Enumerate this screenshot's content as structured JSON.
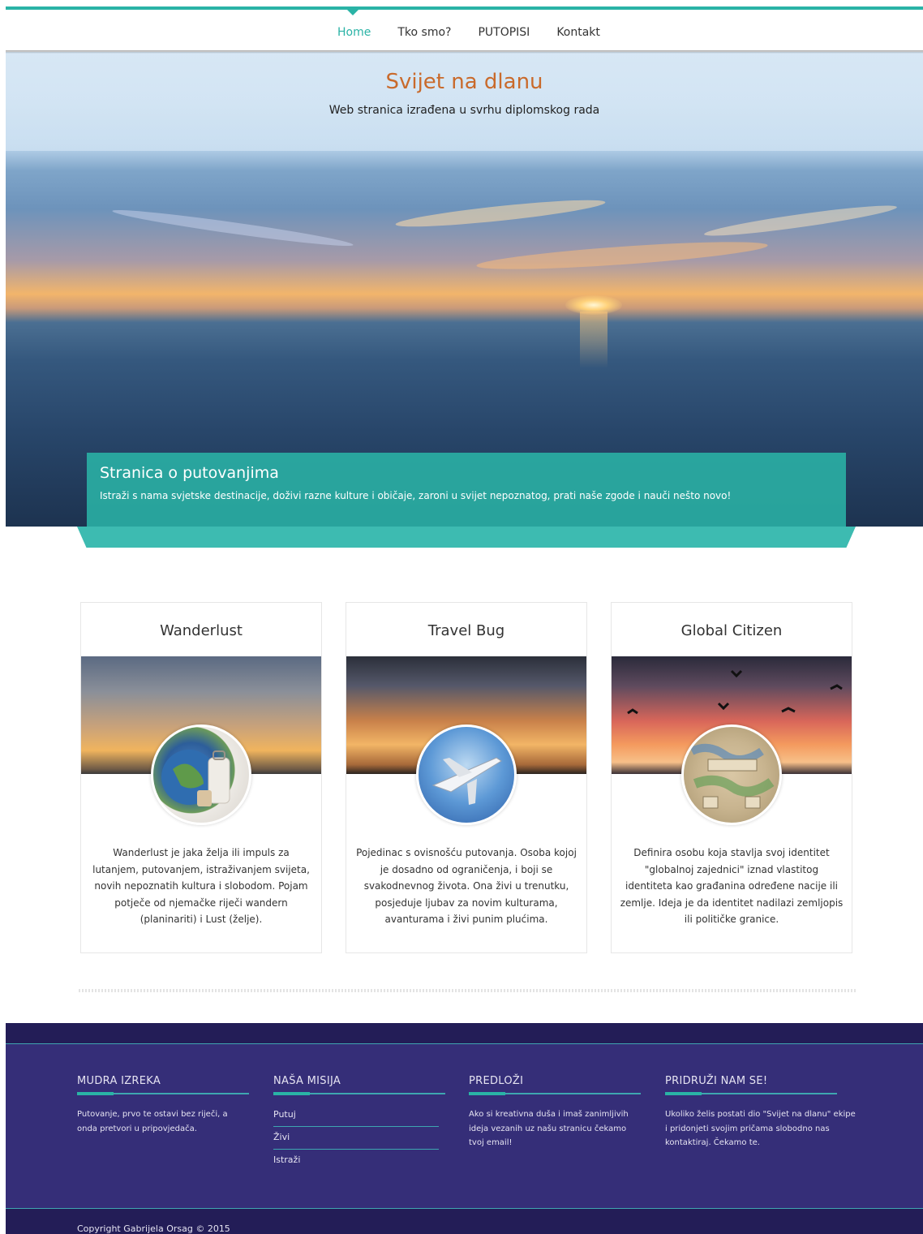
{
  "nav": {
    "items": [
      {
        "label": "Home",
        "active": true
      },
      {
        "label": "Tko smo?",
        "active": false
      },
      {
        "label": "PUTOPISI",
        "active": false
      },
      {
        "label": "Kontakt",
        "active": false
      }
    ]
  },
  "hero": {
    "title": "Svijet na dlanu",
    "subtitle": "Web stranica izrađena u svrhu diplomskog rada",
    "banner_title": "Stranica o putovanjima",
    "banner_text": "Istraži s nama svjetske destinacije, doživi razne kulture i običaje, zaroni u svijet nepoznatog, prati naše zgode i nauči nešto novo!"
  },
  "cards": [
    {
      "title": "Wanderlust",
      "text": "Wanderlust je jaka želja ili impuls za lutanjem, putovanjem, istraživanjem svijeta, novih nepoznatih kultura i slobodom. Pojam potječe od njemačke riječi wandern (planinariti) i Lust (želje)."
    },
    {
      "title": "Travel Bug",
      "text": "Pojedinac s ovisnošću putovanja. Osoba kojoj je dosadno od ograničenja, i boji se svakodnevnog života. Ona živi u trenutku, posjeduje ljubav za novim kulturama, avanturama i živi punim plućima."
    },
    {
      "title": "Global Citizen",
      "text": "Definira osobu koja stavlja svoj identitet \"globalnoj zajednici\" iznad vlastitog identiteta kao građanina određene nacije ili zemlje. Ideja je da identitet nadilazi zemljopis ili političke granice."
    }
  ],
  "footer": {
    "columns": [
      {
        "title": "MUDRA IZREKA",
        "text": "Putovanje, prvo te ostavi bez riječi, a onda pretvori u pripovjedača."
      },
      {
        "title": "NAŠA MISIJA",
        "links": [
          "Putuj",
          "Živi",
          "Istraži"
        ]
      },
      {
        "title": "PREDLOŽI",
        "text": "Ako si kreativna duša i imaš zanimljivih ideja vezanih uz našu stranicu čekamo tvoj email!"
      },
      {
        "title": "PRIDRUŽI NAM SE!",
        "text": "Ukoliko želis postati dio \"Svijet na dlanu\" ekipe i pridonjeti svojim pričama slobodno nas kontaktiraj. Čekamo te."
      }
    ],
    "copyright": "Copyright Gabrijela Orsag © 2015"
  },
  "colors": {
    "accent": "#2ab3a6",
    "title_orange": "#c96a2b",
    "footer_bg": "#352e78",
    "footer_dark": "#231d57"
  }
}
